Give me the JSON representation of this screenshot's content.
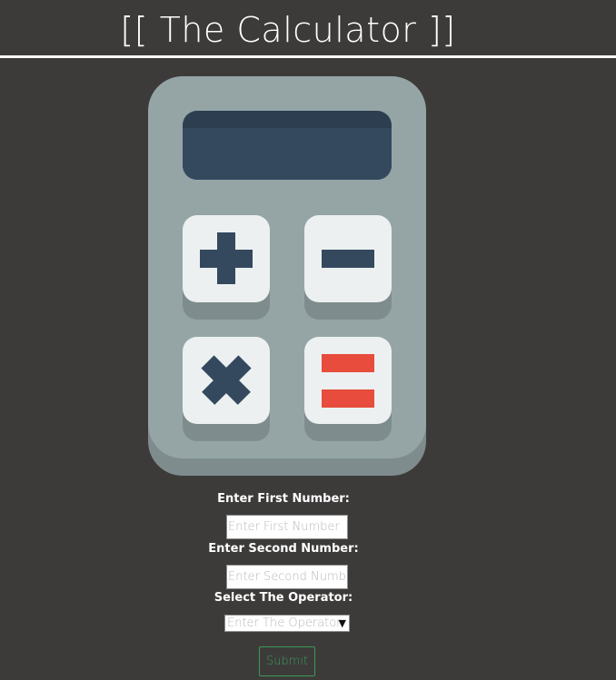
{
  "header": {
    "title": "[[ The Calculator ]]"
  },
  "calculator_illustration": {
    "icon": "calculator-icon",
    "keys": [
      "plus-icon",
      "minus-icon",
      "multiply-icon",
      "equals-icon"
    ],
    "colors": {
      "body": "#95a5a6",
      "screen": "#34495e",
      "key": "#ecf0f1",
      "equals": "#e74c3c"
    }
  },
  "form": {
    "first_number": {
      "label": "Enter First Number:",
      "placeholder": "Enter First Number",
      "value": ""
    },
    "second_number": {
      "label": "Enter Second Number:",
      "placeholder": "Enter Second Number",
      "value": ""
    },
    "operator": {
      "label": "Select The Operator:",
      "selected": "Enter The Operator"
    },
    "submit_label": "Submit"
  },
  "colors": {
    "background": "#3d3b3a",
    "text": "#ffffff",
    "submit": "#3a9a56"
  }
}
